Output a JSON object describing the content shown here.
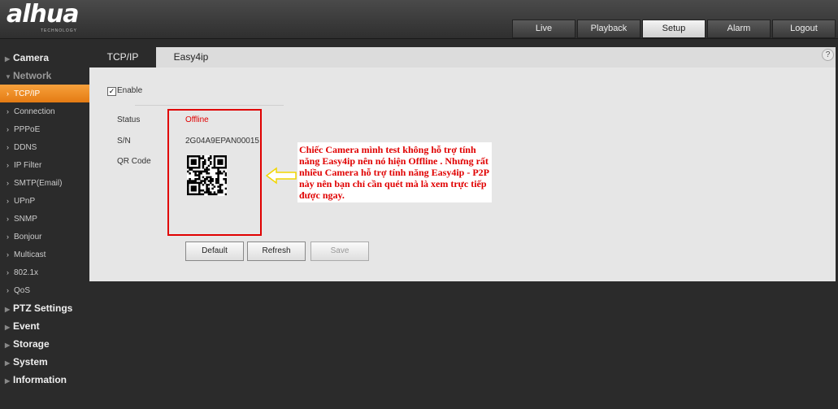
{
  "logo": {
    "wordmark": "alhua",
    "sub": "TECHNOLOGY"
  },
  "topnav": [
    "Live",
    "Playback",
    "Setup",
    "Alarm",
    "Logout"
  ],
  "topnav_active": "Setup",
  "sidebar": [
    {
      "label": "Camera",
      "level": "top"
    },
    {
      "label": "Network",
      "level": "top",
      "dim": true
    },
    {
      "label": "TCP/IP",
      "level": "sub",
      "active": true
    },
    {
      "label": "Connection",
      "level": "sub"
    },
    {
      "label": "PPPoE",
      "level": "sub"
    },
    {
      "label": "DDNS",
      "level": "sub"
    },
    {
      "label": "IP Filter",
      "level": "sub"
    },
    {
      "label": "SMTP(Email)",
      "level": "sub"
    },
    {
      "label": "UPnP",
      "level": "sub"
    },
    {
      "label": "SNMP",
      "level": "sub"
    },
    {
      "label": "Bonjour",
      "level": "sub"
    },
    {
      "label": "Multicast",
      "level": "sub"
    },
    {
      "label": "802.1x",
      "level": "sub"
    },
    {
      "label": "QoS",
      "level": "sub"
    },
    {
      "label": "PTZ Settings",
      "level": "top"
    },
    {
      "label": "Event",
      "level": "top"
    },
    {
      "label": "Storage",
      "level": "top"
    },
    {
      "label": "System",
      "level": "top"
    },
    {
      "label": "Information",
      "level": "top"
    }
  ],
  "tabs": [
    "TCP/IP",
    "Easy4ip"
  ],
  "active_tab": "Easy4ip",
  "form": {
    "enable_label": "Enable",
    "enable_checked": true,
    "status_label": "Status",
    "status_value": "Offline",
    "sn_label": "S/N",
    "sn_value": "2G04A9EPAN00015",
    "qr_label": "QR Code"
  },
  "annotation": "Chiếc Camera mình test không hỗ trợ tính năng Easy4ip nên nó hiện Offline . Nhưng rất nhiều Camera hỗ trợ tính năng Easy4ip - P2P này nên bạn chỉ cần quét mà là xem trực tiếp được ngay.",
  "buttons": {
    "default": "Default",
    "refresh": "Refresh",
    "save": "Save"
  },
  "colors": {
    "accent": "#f08c1e",
    "status_offline": "#e00000",
    "annotation_red": "#e00000"
  }
}
